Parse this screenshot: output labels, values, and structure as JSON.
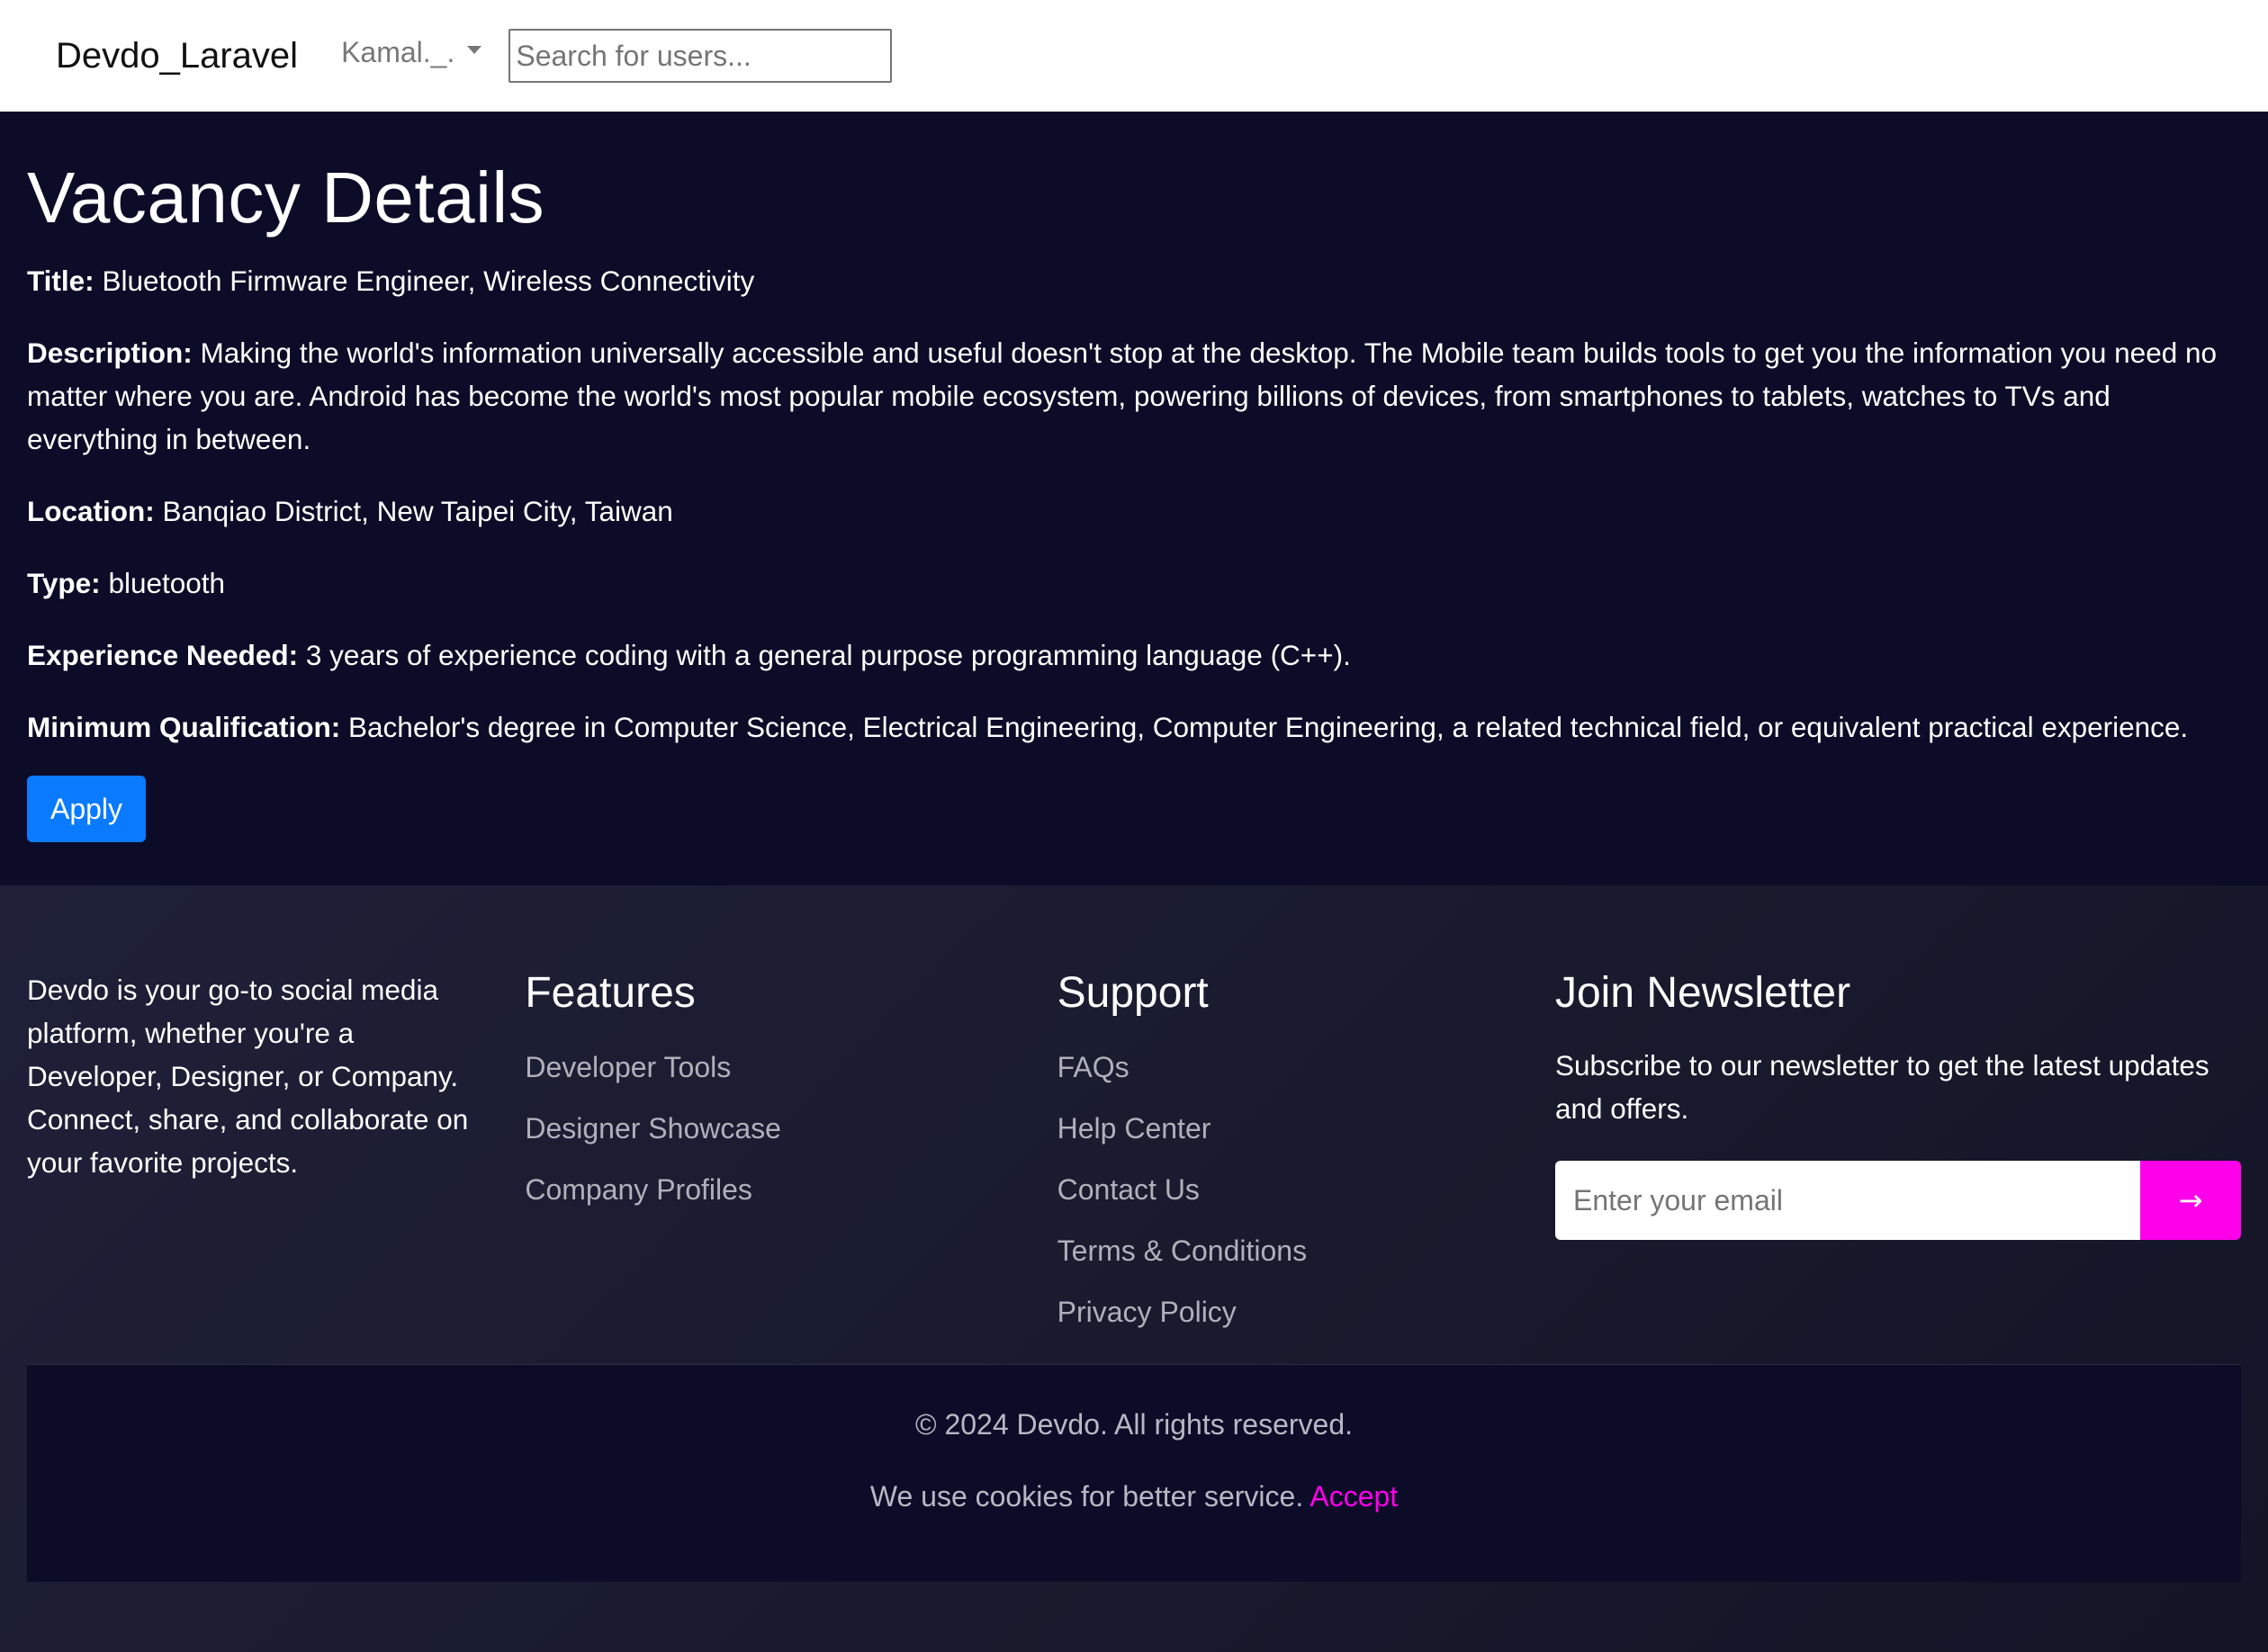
{
  "navbar": {
    "brand": "Devdo_Laravel",
    "user_menu_label": "Kamal._.",
    "search_placeholder": "Search for users..."
  },
  "vacancy": {
    "page_title": "Vacancy Details",
    "fields": [
      {
        "label": "Title:",
        "value": "Bluetooth Firmware Engineer, Wireless Connectivity"
      },
      {
        "label": "Description:",
        "value": "Making the world's information universally accessible and useful doesn't stop at the desktop. The Mobile team builds tools to get you the information you need no matter where you are. Android has become the world's most popular mobile ecosystem, powering billions of devices, from smartphones to tablets, watches to TVs and everything in between."
      },
      {
        "label": "Location:",
        "value": "Banqiao District, New Taipei City, Taiwan"
      },
      {
        "label": "Type:",
        "value": "bluetooth"
      },
      {
        "label": "Experience Needed:",
        "value": "3 years of experience coding with a general purpose programming language (C++)."
      },
      {
        "label": "Minimum Qualification:",
        "value": "Bachelor's degree in Computer Science, Electrical Engineering, Computer Engineering, a related technical field, or equivalent practical experience."
      }
    ],
    "apply_label": "Apply"
  },
  "footer": {
    "about": "Devdo is your go-to social media platform, whether you're a Developer, Designer, or Company. Connect, share, and collaborate on your favorite projects.",
    "features": {
      "heading": "Features",
      "links": [
        "Developer Tools",
        "Designer Showcase",
        "Company Profiles"
      ]
    },
    "support": {
      "heading": "Support",
      "links": [
        "FAQs",
        "Help Center",
        "Contact Us",
        "Terms & Conditions",
        "Privacy Policy"
      ]
    },
    "newsletter": {
      "heading": "Join Newsletter",
      "text": "Subscribe to our newsletter to get the latest updates and offers.",
      "email_placeholder": "Enter your email",
      "submit_glyph": "→"
    },
    "copyright": "© 2024 Devdo. All rights reserved.",
    "cookie_text": "We use cookies for better service.",
    "cookie_accept": "Accept"
  },
  "colors": {
    "main_bg": "#0c0c28",
    "footer_bg": "#1b1c30",
    "apply_button": "#0a7bff",
    "accent_magenta": "#ff00ea"
  },
  "icons": {
    "user_menu": "caret-down-icon",
    "newsletter_submit": "arrow-right-icon"
  }
}
